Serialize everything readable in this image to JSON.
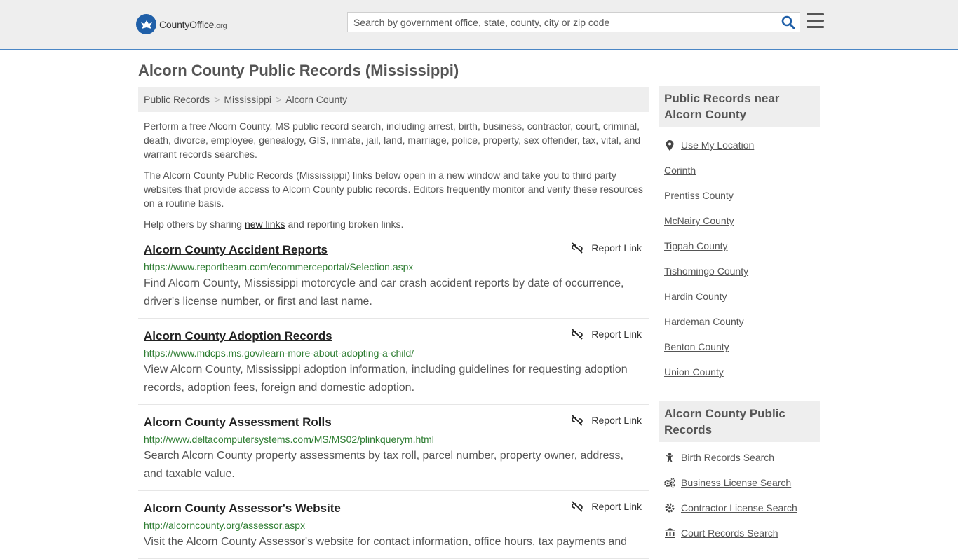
{
  "header": {
    "logo_main": "CountyOffice",
    "logo_tld": ".org",
    "search_placeholder": "Search by government office, state, county, city or zip code"
  },
  "page_title": "Alcorn County Public Records (Mississippi)",
  "breadcrumb": [
    "Public Records",
    "Mississippi",
    "Alcorn County"
  ],
  "intro": {
    "p1": "Perform a free Alcorn County, MS public record search, including arrest, birth, business, contractor, court, criminal, death, divorce, employee, genealogy, GIS, inmate, jail, land, marriage, police, property, sex offender, tax, vital, and warrant records searches.",
    "p2": "The Alcorn County Public Records (Mississippi) links below open in a new window and take you to third party websites that provide access to Alcorn County public records. Editors frequently monitor and verify these resources on a routine basis.",
    "p3_before": "Help others by sharing ",
    "p3_link": "new links",
    "p3_after": " and reporting broken links."
  },
  "report_label": "Report Link",
  "records": [
    {
      "title": "Alcorn County Accident Reports",
      "url": "https://www.reportbeam.com/ecommerceportal/Selection.aspx",
      "desc": "Find Alcorn County, Mississippi motorcycle and car crash accident reports by date of occurrence, driver's license number, or first and last name."
    },
    {
      "title": "Alcorn County Adoption Records",
      "url": "https://www.mdcps.ms.gov/learn-more-about-adopting-a-child/",
      "desc": "View Alcorn County, Mississippi adoption information, including guidelines for requesting adoption records, adoption fees, foreign and domestic adoption."
    },
    {
      "title": "Alcorn County Assessment Rolls",
      "url": "http://www.deltacomputersystems.com/MS/MS02/plinkquerym.html",
      "desc": "Search Alcorn County property assessments by tax roll, parcel number, property owner, address, and taxable value."
    },
    {
      "title": "Alcorn County Assessor's Website",
      "url": "http://alcorncounty.org/assessor.aspx",
      "desc": "Visit the Alcorn County Assessor's website for contact information, office hours, tax payments and"
    }
  ],
  "sidebar": {
    "nearby_title": "Public Records near Alcorn County",
    "use_location": "Use My Location",
    "nearby": [
      "Corinth",
      "Prentiss County",
      "McNairy County",
      "Tippah County",
      "Tishomingo County",
      "Hardin County",
      "Hardeman County",
      "Benton County",
      "Union County"
    ],
    "records_title": "Alcorn County Public Records",
    "record_links": [
      {
        "label": "Birth Records Search",
        "icon": "baby-icon"
      },
      {
        "label": "Business License Search",
        "icon": "gears-icon"
      },
      {
        "label": "Contractor License Search",
        "icon": "gear-icon"
      },
      {
        "label": "Court Records Search",
        "icon": "courthouse-icon"
      }
    ]
  }
}
